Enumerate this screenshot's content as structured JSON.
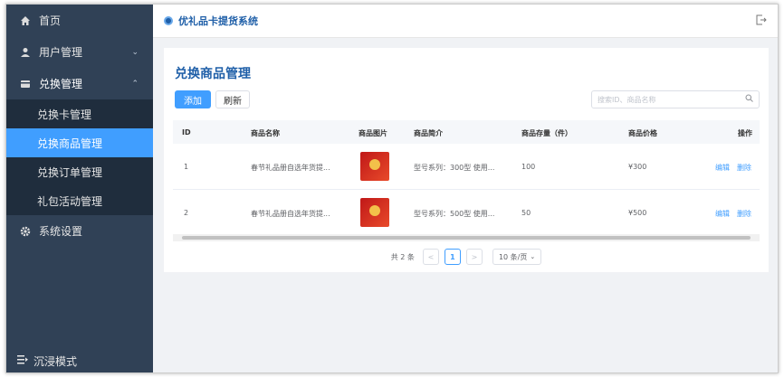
{
  "sidebar": {
    "items": [
      {
        "label": "首页",
        "icon": "home-icon"
      },
      {
        "label": "用户管理",
        "icon": "user-icon",
        "arrow": "⌄"
      },
      {
        "label": "兑换管理",
        "icon": "card-icon",
        "arrow": "⌃"
      }
    ],
    "sub_items": [
      {
        "label": "兑换卡管理"
      },
      {
        "label": "兑换商品管理"
      },
      {
        "label": "兑换订单管理"
      },
      {
        "label": "礼包活动管理"
      }
    ],
    "settings": {
      "label": "系统设置",
      "icon": "gear-icon"
    },
    "bottom": {
      "label": "沉浸模式",
      "icon": "menu-fold-icon"
    }
  },
  "topbar": {
    "title": "优礼品卡提货系统"
  },
  "page": {
    "title": "兑换商品管理",
    "add_label": "添加",
    "refresh_label": "刷新",
    "search_placeholder": "搜索ID、商品名称"
  },
  "table": {
    "headers": [
      "ID",
      "商品名称",
      "商品图片",
      "商品简介",
      "商品存量（件）",
      "商品价格",
      "操作"
    ],
    "rows": [
      {
        "id": "1",
        "name": "春节礼品册自选年货提...",
        "intro": "型号系列：300型 使用...",
        "stock": "100",
        "price": "¥300",
        "edit": "编辑",
        "delete": "删除"
      },
      {
        "id": "2",
        "name": "春节礼品册自选年货提...",
        "intro": "型号系列：500型 使用...",
        "stock": "50",
        "price": "¥500",
        "edit": "编辑",
        "delete": "删除"
      }
    ]
  },
  "pager": {
    "total": "共 2 条",
    "prev": "<",
    "current": "1",
    "next": ">",
    "size": "10 条/页"
  },
  "colors": {
    "sidebar": "#304156",
    "active": "#409eff",
    "accent": "#1f5fa8"
  }
}
